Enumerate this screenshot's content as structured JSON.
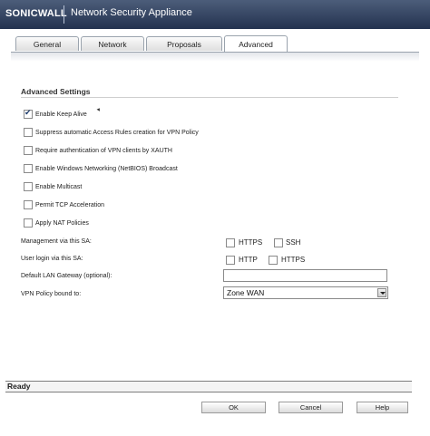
{
  "header": {
    "logo_text": "SONICWALL",
    "title": "Network Security Appliance"
  },
  "tabs": [
    {
      "label": "General",
      "active": false
    },
    {
      "label": "Network",
      "active": false
    },
    {
      "label": "Proposals",
      "active": false
    },
    {
      "label": "Advanced",
      "active": true
    }
  ],
  "advanced": {
    "section_title": "Advanced Settings",
    "options": [
      {
        "label": "Enable Keep Alive",
        "checked": true
      },
      {
        "label": "Suppress automatic Access Rules creation for VPN Policy",
        "checked": false
      },
      {
        "label": "Require authentication of VPN clients by XAUTH",
        "checked": false
      },
      {
        "label": "Enable Windows Networking (NetBIOS) Broadcast",
        "checked": false
      },
      {
        "label": "Enable Multicast",
        "checked": false
      },
      {
        "label": "Permit TCP Acceleration",
        "checked": false
      },
      {
        "label": "Apply NAT Policies",
        "checked": false
      }
    ],
    "management": {
      "label": "Management via this SA:",
      "options": [
        {
          "label": "HTTPS",
          "checked": false
        },
        {
          "label": "SSH",
          "checked": false
        }
      ]
    },
    "user_login": {
      "label": "User login via this SA:",
      "options": [
        {
          "label": "HTTP",
          "checked": false
        },
        {
          "label": "HTTPS",
          "checked": false
        }
      ]
    },
    "default_gateway": {
      "label": "Default LAN Gateway (optional):",
      "value": ""
    },
    "vpn_bound": {
      "label": "VPN Policy bound to:",
      "value": "Zone WAN"
    }
  },
  "status": {
    "text": "Ready"
  },
  "buttons": {
    "ok": "OK",
    "cancel": "Cancel",
    "help": "Help"
  }
}
